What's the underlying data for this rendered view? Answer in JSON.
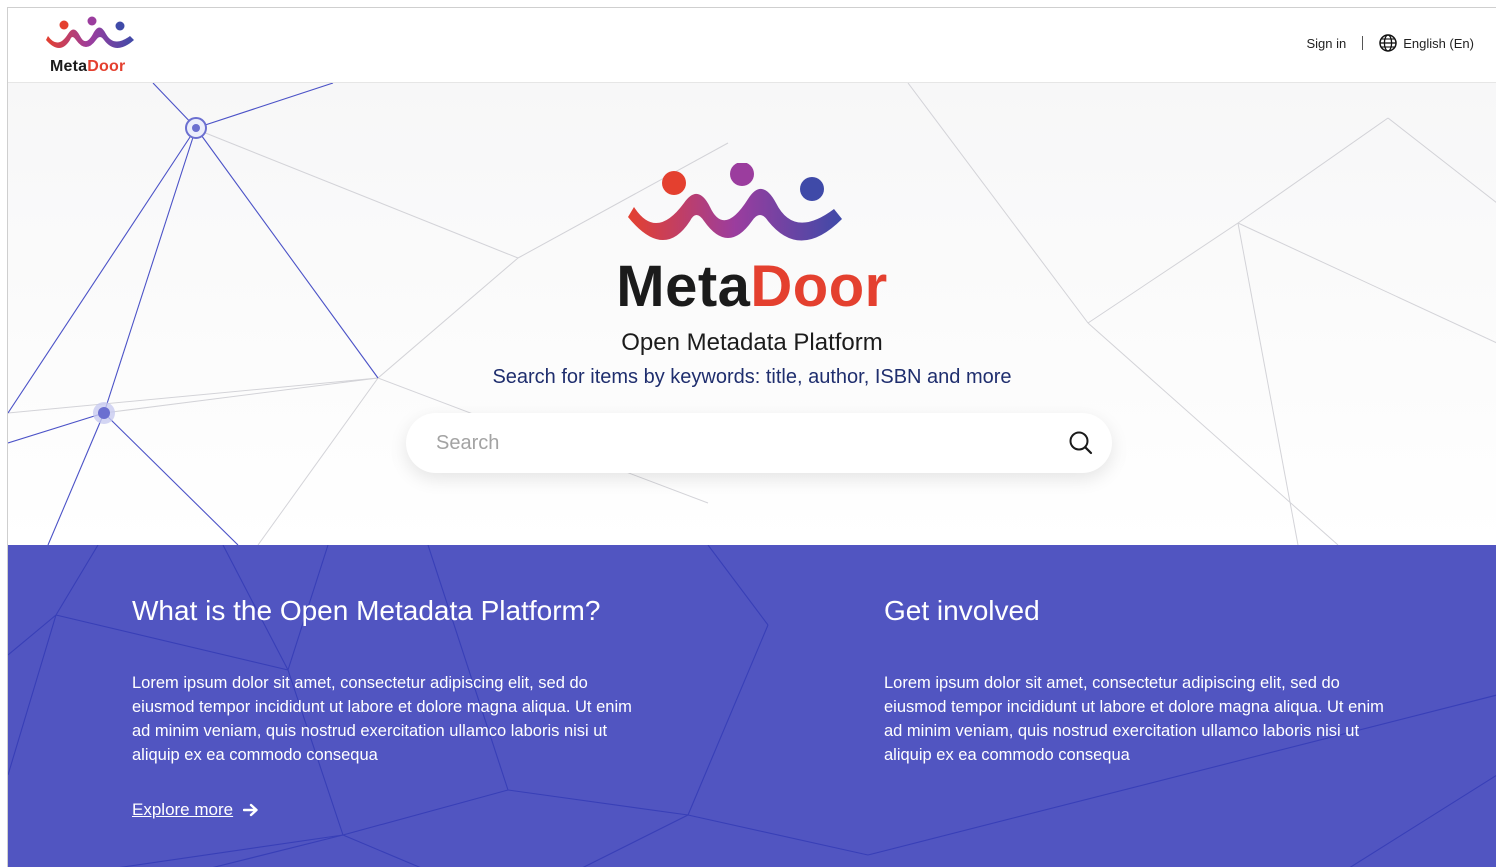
{
  "header": {
    "logo_text_meta": "Meta",
    "logo_text_door": "Door",
    "signin_label": "Sign in",
    "language_label": "English (En)",
    "language_icon": "globe-icon"
  },
  "hero": {
    "brand_meta": "Meta",
    "brand_door": "Door",
    "subtitle": "Open Metadata Platform",
    "search_hint": "Search for items by keywords: title, author, ISBN and more",
    "search_placeholder": "Search",
    "search_icon": "search-icon"
  },
  "info": {
    "about": {
      "title": "What is the Open Metadata Platform?",
      "body": "Lorem ipsum dolor sit amet, consectetur adipiscing elit, sed do eiusmod tempor incididunt ut labore et dolore magna aliqua. Ut enim ad minim veniam, quis nostrud exercitation ullamco laboris nisi ut aliquip ex ea commodo consequa",
      "link_label": "Explore more",
      "link_icon": "arrow-right-icon"
    },
    "involved": {
      "title": "Get involved",
      "body": "Lorem ipsum dolor sit amet, consectetur adipiscing elit, sed do eiusmod tempor incididunt ut labore et dolore magna aliqua. Ut enim ad minim veniam, quis nostrud exercitation ullamco laboris nisi ut aliquip ex ea commodo consequa"
    }
  },
  "colors": {
    "brand_red": "#e4402f",
    "brand_purple": "#9b3d9e",
    "brand_blue": "#3f4aa8",
    "band_blue": "#5155c1",
    "hint_navy": "#1f2e6e"
  }
}
